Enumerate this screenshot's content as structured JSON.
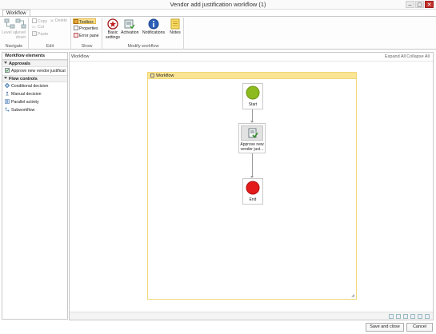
{
  "window": {
    "title": "Vendor add justification workflow (1)",
    "controls": {
      "minimize": "–",
      "maximize": "▢",
      "close": "✕"
    }
  },
  "ribbon": {
    "tab": "Workflow",
    "groups": {
      "navigate": {
        "label": "Navigate",
        "level_up": "Level up",
        "level_down": "Level down"
      },
      "edit": {
        "label": "Edit",
        "copy": "Copy",
        "delete": "Delete",
        "cut": "Cut",
        "paste": "Paste"
      },
      "show": {
        "label": "Show",
        "toolbox": "Toolbox",
        "properties": "Properties",
        "error_pane": "Error pane"
      },
      "modify": {
        "label": "Modify workflow",
        "basic_settings_1": "Basic",
        "basic_settings_2": "settings",
        "activation": "Activation",
        "notifications": "Notifications",
        "notes": "Notes"
      }
    }
  },
  "elements_panel": {
    "header": "Workflow elements",
    "sections": [
      {
        "title": "Approvals",
        "items": [
          "Approve new vendor justificat"
        ]
      },
      {
        "title": "Flow controls",
        "items": [
          "Conditional decision",
          "Manual decision",
          "Parallel activity",
          "Subworkflow"
        ]
      }
    ]
  },
  "designer": {
    "breadcrumb": "Workflow",
    "expand_all": "Expand All",
    "collapse_all": "Collapse All",
    "container_title": "Workflow",
    "nodes": {
      "start": "Start",
      "approval_line1": "Approve new",
      "approval_line2": "vendor just...",
      "end": "End"
    },
    "colors": {
      "start": "#8dbb1f",
      "end": "#e31b1b",
      "header": "#fbe594"
    }
  },
  "footer": {
    "save_close": "Save and close",
    "cancel": "Cancel"
  }
}
